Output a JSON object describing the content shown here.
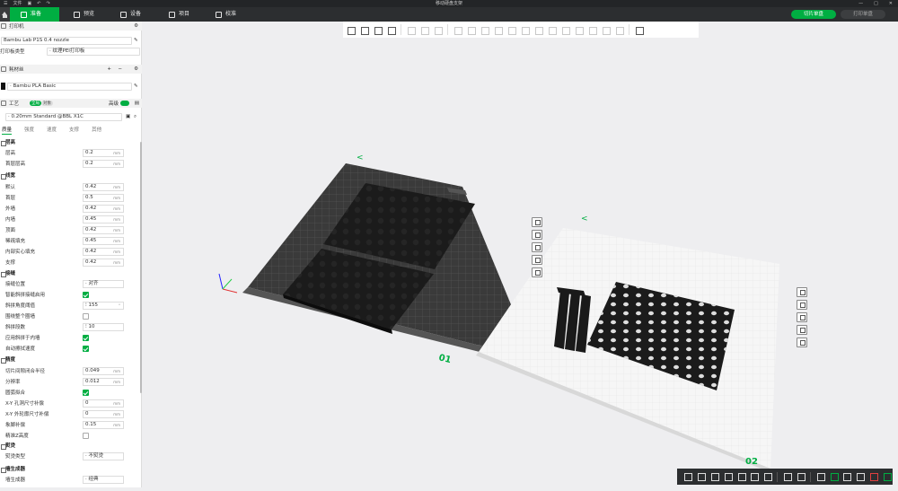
{
  "titlebar": {
    "menu": "文件",
    "title": "移动硬盘支架"
  },
  "tabs": [
    {
      "label": "准备"
    },
    {
      "label": "预览"
    },
    {
      "label": "设备"
    },
    {
      "label": "项目"
    },
    {
      "label": "校准"
    }
  ],
  "actions": {
    "slice": "切片单盘",
    "print": "打印单盘"
  },
  "printer": {
    "section": "打印机",
    "name": "Bambu Lab P1S 0.4 nozzle",
    "plate_label": "打印板类型",
    "plate_value": "纹理PEI打印板"
  },
  "filament": {
    "section": "耗材丝",
    "name": "Bambu PLA Basic",
    "color": "#111111"
  },
  "process": {
    "section": "工艺",
    "toggle_a": "全局",
    "toggle_b": "对象",
    "advanced_label": "高级",
    "preset": "0.20mm Standard @BBL X1C",
    "subtabs": [
      "质量",
      "强度",
      "速度",
      "支撑",
      "其他"
    ]
  },
  "groups": {
    "layer_height": {
      "title": "层高",
      "rows": [
        {
          "label": "层高",
          "value": "0.2",
          "unit": "mm"
        },
        {
          "label": "首层层高",
          "value": "0.2",
          "unit": "mm"
        }
      ]
    },
    "line_width": {
      "title": "线宽",
      "rows": [
        {
          "label": "默认",
          "value": "0.42",
          "unit": "mm"
        },
        {
          "label": "首层",
          "value": "0.5",
          "unit": "mm"
        },
        {
          "label": "外墙",
          "value": "0.42",
          "unit": "mm"
        },
        {
          "label": "内墙",
          "value": "0.45",
          "unit": "mm"
        },
        {
          "label": "顶面",
          "value": "0.42",
          "unit": "mm"
        },
        {
          "label": "稀疏填充",
          "value": "0.45",
          "unit": "mm"
        },
        {
          "label": "内部实心填充",
          "value": "0.42",
          "unit": "mm"
        },
        {
          "label": "支撑",
          "value": "0.42",
          "unit": "mm"
        }
      ]
    },
    "seam": {
      "title": "接缝",
      "position_label": "接缝位置",
      "position_value": "对齐",
      "smart_scarf_label": "智能斜拼接缝启用",
      "scarf_angle_label": "斜拼角度阈值",
      "scarf_angle_value": "155",
      "scarf_angle_unit": "°",
      "entire_loop_label": "围绕整个圈墙",
      "steps_label": "斜拼段数",
      "steps_value": "10",
      "inner_walls_label": "应用斜拼于内墙",
      "wipe_label": "自动擦拭速度"
    },
    "precision": {
      "title": "精度",
      "rows": [
        {
          "label": "切片间隙闭合半径",
          "value": "0.049",
          "unit": "mm"
        },
        {
          "label": "分辨率",
          "value": "0.012",
          "unit": "mm"
        }
      ],
      "arc_label": "圆弧拟合",
      "rows2": [
        {
          "label": "X-Y 孔洞尺寸补偿",
          "value": "0",
          "unit": "mm"
        },
        {
          "label": "X-Y 外轮廓尺寸补偿",
          "value": "0",
          "unit": "mm"
        },
        {
          "label": "象脚补偿",
          "value": "0.15",
          "unit": "mm"
        }
      ],
      "precise_z_label": "精准Z高度"
    },
    "ironing": {
      "title": "熨烫",
      "type_label": "熨烫类型",
      "type_value": "不熨烫"
    },
    "wall_generator": {
      "title": "墙生成器",
      "label": "墙生成器",
      "value": "经典"
    }
  },
  "viewport": {
    "plate1": "01",
    "plate2": "02"
  }
}
